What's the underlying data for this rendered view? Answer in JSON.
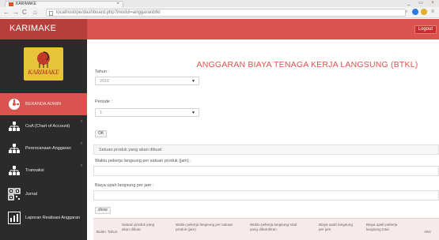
{
  "browser": {
    "tab_title": "KARIMAKE",
    "tab_close": "×",
    "url": "localhost/pe/dashboard.php?modul=anggaranbtkl",
    "window_buttons": [
      "_",
      "▭",
      "×"
    ]
  },
  "header": {
    "brand": "KARIMAKE",
    "logout_label": "Logout"
  },
  "sidebar": {
    "logo_text": "KARIMAKE",
    "items": [
      {
        "label": "BERANDA ADMIN",
        "icon": "dashboard-icon",
        "active": true
      },
      {
        "label": "CoA (Chart of Account)",
        "icon": "sitemap-icon"
      },
      {
        "label": "Perencanaan Anggaran",
        "icon": "sitemap-icon"
      },
      {
        "label": "Transaksi",
        "icon": "sitemap-icon"
      },
      {
        "label": "Jurnal",
        "icon": "qr-icon"
      },
      {
        "label": "Laporan Realisasi Anggaran",
        "icon": "bar-chart-icon"
      }
    ]
  },
  "main": {
    "title": "ANGGARAN BIAYA TENAGA KERJA LANGSUNG (BTKL)",
    "tahun_label": "Tahun :",
    "tahun_value": "2016",
    "periode_label": "Periode :",
    "periode_value": "1",
    "ok_label": "OK",
    "produk_text": "Satuan produk yang akan dibuat",
    "waktu_label": "Waktu pekerja langsung per satuan produk (jam) :",
    "biaya_label": "Biaya upah langsung per jam :",
    "show_label": "show",
    "table_headers": [
      "Bulan",
      "Tahun",
      "Satuan produk yang akan dibuat",
      "Waktu pekerja langsung per satuan produk (jam)",
      "Waktu pekerja langsung total yang dibutuhkan",
      "Biaya upah langsung per jam",
      "Biaya upah pekerja langsung total",
      "Aksi"
    ]
  },
  "colors": {
    "accent": "#d9534f",
    "sidebar": "#2b2b2b"
  }
}
